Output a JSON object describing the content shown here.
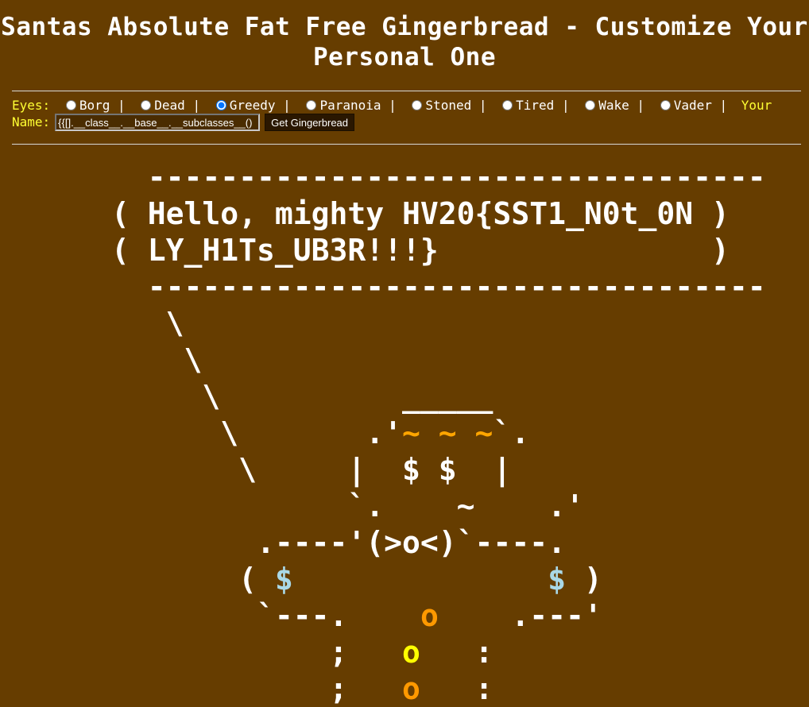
{
  "page": {
    "title": "Santas Absolute Fat Free Gingerbread - Customize Your Personal One"
  },
  "form": {
    "eyes_label": "Eyes:",
    "eye_options": [
      {
        "label": "Borg",
        "checked": false
      },
      {
        "label": "Dead",
        "checked": false
      },
      {
        "label": "Greedy",
        "checked": true
      },
      {
        "label": "Paranoia",
        "checked": false
      },
      {
        "label": "Stoned",
        "checked": false
      },
      {
        "label": "Tired",
        "checked": false
      },
      {
        "label": "Wake",
        "checked": false
      },
      {
        "label": "Vader",
        "checked": false
      }
    ],
    "separator": "|",
    "name_label": "Your Name:",
    "name_value": "{{[].__class__.__base__.__subclasses__()",
    "submit_label": "Get Gingerbread"
  },
  "art": {
    "bubble_top": "  ----------------------------------",
    "bubble_line1": "( Hello, mighty HV20{SST1_N0t_0N )",
    "bubble_line2": "( LY_H1Ts_UB3R!!!}               )",
    "bubble_bottom": "  ----------------------------------",
    "tail1": "   \\",
    "tail2": "    \\",
    "tail3": "     \\          _____",
    "head_left": "      \\       .'",
    "eye_tildes": "~ ~ ~",
    "head_right": "`.",
    "face_left": "       \\     |  ",
    "face_eyes": "$ $",
    "face_right": "  |",
    "chin": "             `.    ~    .'",
    "body_top": "        .----'(>o<)`----.",
    "arm_left_open": "       ( ",
    "arm_dollar_left": "$",
    "arm_gap": "              ",
    "arm_dollar_right": "$",
    "arm_right_close": " )",
    "arm_bottom_left": "        `---.    ",
    "button1": "o",
    "arm_bottom_right": "    .---'",
    "leg_left1": "            ;   ",
    "button2": "o",
    "leg_right1": "   :",
    "leg_left2": "            ;   ",
    "button3": "o",
    "leg_right2": "   :"
  },
  "colors": {
    "background": "#663d00",
    "label_yellow": "#ffff33",
    "eye_orange": "#ffa500",
    "dollar_blue": "#a9d8e6",
    "button_orange": "#ff9900",
    "button_yellow": "#ffff00"
  }
}
